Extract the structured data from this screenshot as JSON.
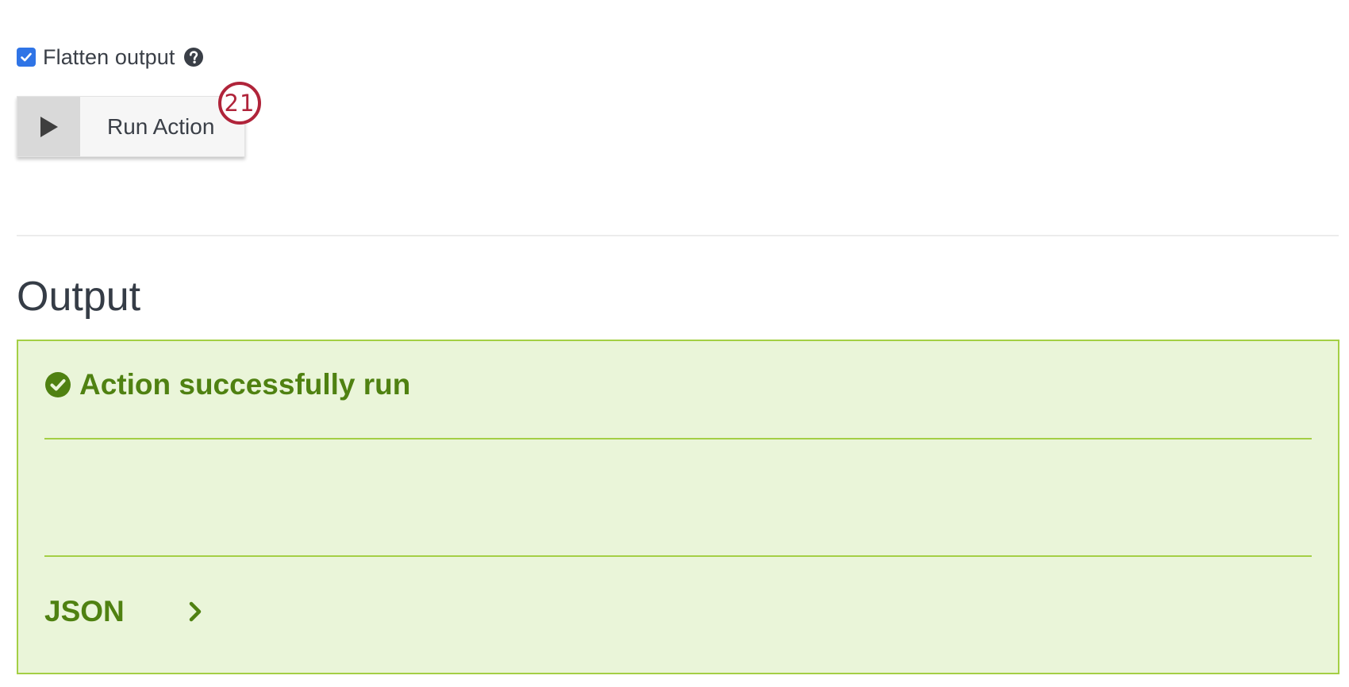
{
  "options": {
    "flatten_output": {
      "label": "Flatten output",
      "checked": true,
      "help_icon": "question-circle-icon"
    }
  },
  "run_button": {
    "icon": "play-icon",
    "label": "Run Action"
  },
  "annotation": {
    "number": "21"
  },
  "output": {
    "heading": "Output",
    "status": {
      "icon": "check-circle-icon",
      "text": "Action successfully run"
    },
    "json_toggle": {
      "label": "JSON",
      "icon": "chevron-right-icon"
    }
  },
  "colors": {
    "checkbox_blue": "#2f74e6",
    "success_green": "#4f8111",
    "panel_bg": "#eaf5d9",
    "panel_border": "#a4cf45",
    "badge_red": "#b0243a"
  }
}
